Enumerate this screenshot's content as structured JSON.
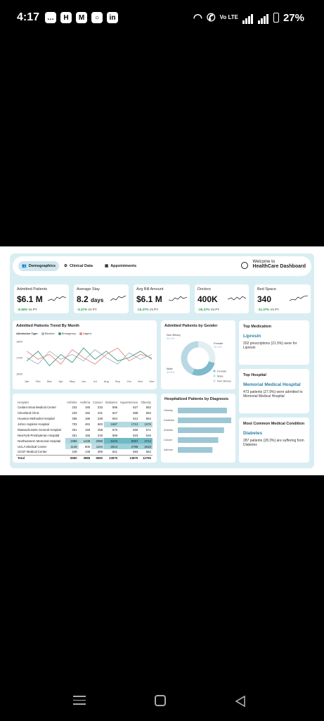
{
  "status_bar": {
    "time": "4:17",
    "battery": "27%",
    "network": "Vo LTE"
  },
  "nav": {
    "tabs": [
      "Demographics",
      "Clinical Data",
      "Appointments"
    ]
  },
  "header": {
    "welcome": "Welcome to",
    "title": "HealthCare Dashboard"
  },
  "kpis": [
    {
      "label": "Admitted Patients",
      "value": "$6.1 M",
      "unit": "",
      "delta": "8.36%",
      "delta_suffix": "Vs PY"
    },
    {
      "label": "Average Stay",
      "value": "8.2",
      "unit": "days",
      "delta": "5.37%",
      "delta_suffix": "Vs PY"
    },
    {
      "label": "Avg Bill Amount",
      "value": "$6.1 M",
      "unit": "",
      "delta": "15.37%",
      "delta_suffix": "Vs PY"
    },
    {
      "label": "Doctors",
      "value": "400K",
      "unit": "",
      "delta": "25.37%",
      "delta_suffix": "Vs PY"
    },
    {
      "label": "Bed Space",
      "value": "340",
      "unit": "",
      "delta": "11.37%",
      "delta_suffix": "Vs PY"
    }
  ],
  "trend": {
    "title": "Admitted Patients Trend By Month",
    "legend_label": "Admission Type",
    "series_names": [
      "Elective",
      "Emergency",
      "Urgent"
    ],
    "colors": [
      "#9fb8c8",
      "#3c9a78",
      "#e58a86"
    ],
    "yticks": [
      "1800",
      "1700",
      "1600"
    ]
  },
  "gender": {
    "title": "Admitted Patients by Gender",
    "labels": [
      "Non Binary",
      "Female",
      "Male"
    ],
    "pcts": [
      "33.1%",
      "30.1%",
      "49.9%"
    ],
    "legend": [
      "Female",
      "Male",
      "Non Binary"
    ]
  },
  "medication": {
    "title": "Top Medication",
    "name": "Lipresin",
    "desc": "202 prescriptions (21.5%) were for Lipresin"
  },
  "hospital": {
    "title": "Top Hospital",
    "name": "Memorial Medical Hospital",
    "desc": "473 patients (27.9%) were admitted to Memorial Medical Hospital"
  },
  "condition": {
    "title": "Most Common Medical Condition",
    "name": "Diabetes",
    "desc": "287 patients (28.3%) are suffering from Diabetes"
  },
  "table": {
    "headers": [
      "Hospital",
      "Arthritis",
      "Asthma",
      "Cancer",
      "Diabetes",
      "Hypertension",
      "Obesity"
    ],
    "rows": [
      [
        "Cedars-Sinai Medical Center",
        "232",
        "165",
        "233",
        "596",
        "627",
        "552"
      ],
      [
        "Cleveland Clinic",
        "233",
        "182",
        "231",
        "627",
        "588",
        "563"
      ],
      [
        "Houston Methodist Hospital",
        "256",
        "186",
        "239",
        "654",
        "612",
        "564"
      ],
      [
        "Johns Hopkins Hospital",
        "703",
        "491",
        "683",
        "1687",
        "1713",
        "1576"
      ],
      [
        "Massachusetts General Hospital",
        "251",
        "159",
        "258",
        "576",
        "656",
        "571"
      ],
      [
        "NewYork-Presbyterian Hospital",
        "251",
        "156",
        "219",
        "569",
        "623",
        "516"
      ],
      [
        "Northwestern Memorial Hospital",
        "1998",
        "1439",
        "2090",
        "5104",
        "5057",
        "4714"
      ],
      [
        "UCLA Medical Center",
        "1145",
        "805",
        "1104",
        "2813",
        "2786",
        "2615"
      ],
      [
        "UCSF Medical Center",
        "248",
        "149",
        "269",
        "621",
        "583",
        "562"
      ]
    ],
    "total": [
      "Total",
      "5550",
      "3885",
      "5550",
      "13875",
      "13875",
      "12765"
    ]
  },
  "diagnosis": {
    "title": "Hospitalized Patients by Diagnosis",
    "labels": [
      "Obesity",
      "Diabetes",
      "Arthritis",
      "Cancer",
      "Asthma"
    ]
  },
  "chart_data": [
    {
      "type": "line",
      "title": "Admitted Patients Trend By Month",
      "x": [
        "Jan",
        "Feb",
        "Mar",
        "Apr",
        "May",
        "Jun",
        "Jul",
        "Aug",
        "Sep",
        "Oct",
        "Nov",
        "Dec"
      ],
      "ylim": [
        1600,
        1800
      ],
      "series": [
        {
          "name": "Elective",
          "values": [
            1700,
            1660,
            1740,
            1690,
            1720,
            1680,
            1750,
            1700,
            1660,
            1730,
            1690,
            1720
          ]
        },
        {
          "name": "Emergency",
          "values": [
            1680,
            1740,
            1650,
            1720,
            1670,
            1760,
            1690,
            1740,
            1680,
            1700,
            1740,
            1690
          ]
        },
        {
          "name": "Urgent",
          "values": [
            1740,
            1690,
            1720,
            1660,
            1750,
            1700,
            1660,
            1720,
            1760,
            1680,
            1720,
            1700
          ]
        }
      ]
    },
    {
      "type": "pie",
      "title": "Admitted Patients by Gender",
      "categories": [
        "Non Binary",
        "Female",
        "Male"
      ],
      "values": [
        33.1,
        30.1,
        49.9
      ]
    },
    {
      "type": "bar",
      "title": "Hospitalized Patients by Diagnosis",
      "categories": [
        "Obesity",
        "Diabetes",
        "Arthritis",
        "Cancer",
        "Asthma"
      ],
      "values": [
        12765,
        13875,
        12000,
        10500,
        9000
      ]
    }
  ]
}
